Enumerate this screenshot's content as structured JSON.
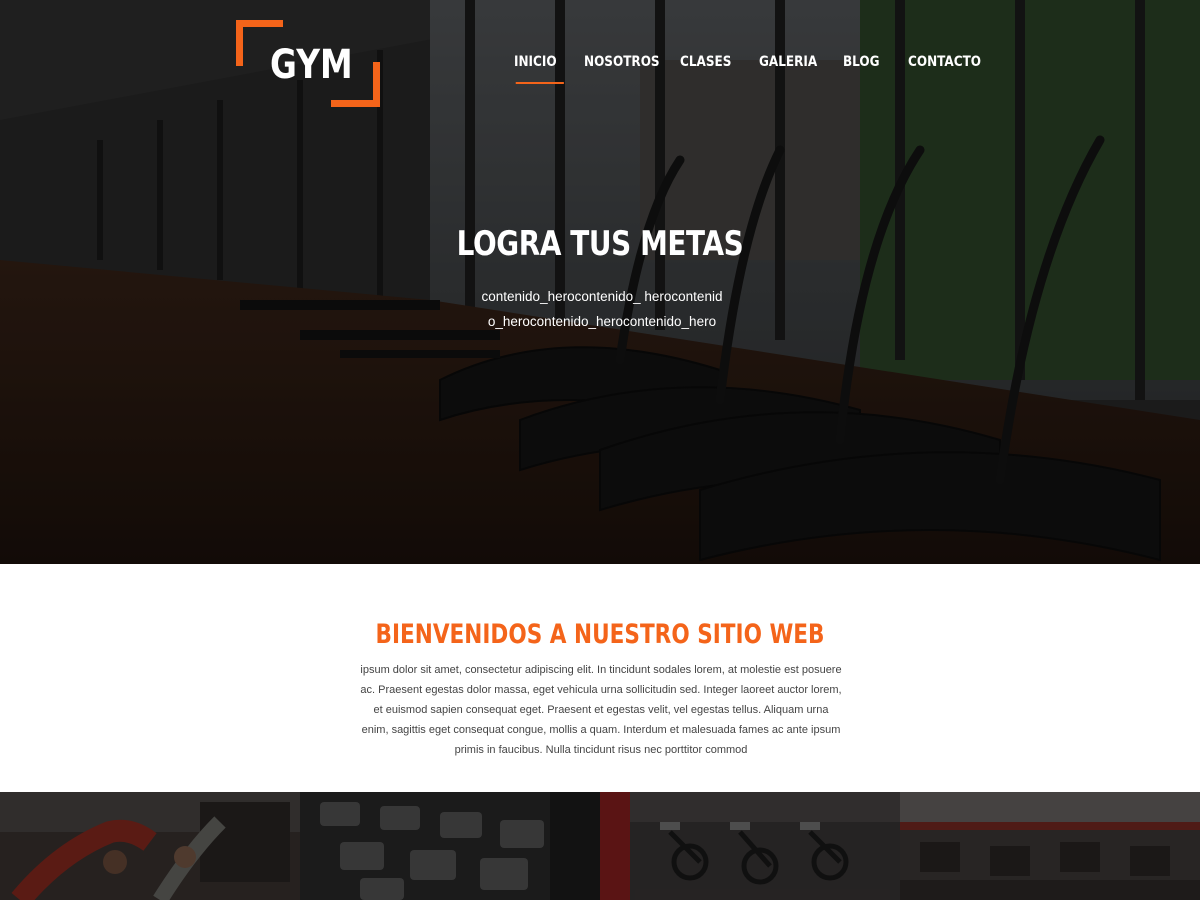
{
  "brand": {
    "logo_text": "GYM",
    "accent_color": "#f4641a"
  },
  "nav": {
    "items": [
      {
        "label": "INICIO",
        "active": true
      },
      {
        "label": "NOSOTROS",
        "active": false
      },
      {
        "label": "CLASES",
        "active": false
      },
      {
        "label": "GALERIA",
        "active": false
      },
      {
        "label": "BLOG",
        "active": false
      },
      {
        "label": "CONTACTO",
        "active": false
      }
    ]
  },
  "hero": {
    "title": "LOGRA TUS METAS",
    "text": "contenido_herocontenido_ herocontenido_herocontenido_herocontenido_hero",
    "background": "gym-treadmills-photo"
  },
  "welcome": {
    "title": "BIENVENIDOS A NUESTRO SITIO WEB",
    "text": "ipsum dolor sit amet, consectetur adipiscing elit. In tincidunt sodales lorem, at molestie est posuere ac. Praesent egestas dolor massa, eget vehicula urna sollicitudin sed. Integer laoreet auctor lorem, et euismod sapien consequat eget. Praesent et egestas velit, vel egestas tellus. Aliquam urna enim, sagittis eget consequat congue, mollis a quam. Interdum et malesuada fames ac ante ipsum primis in faucibus. Nulla tincidunt risus nec porttitor commod"
  },
  "gallery": {
    "tiles": [
      {
        "subject": "stretching-class-photo"
      },
      {
        "subject": "dumbbell-rack-photo"
      },
      {
        "subject": "spinning-bikes-photo"
      },
      {
        "subject": "gym-floor-photo"
      }
    ]
  }
}
